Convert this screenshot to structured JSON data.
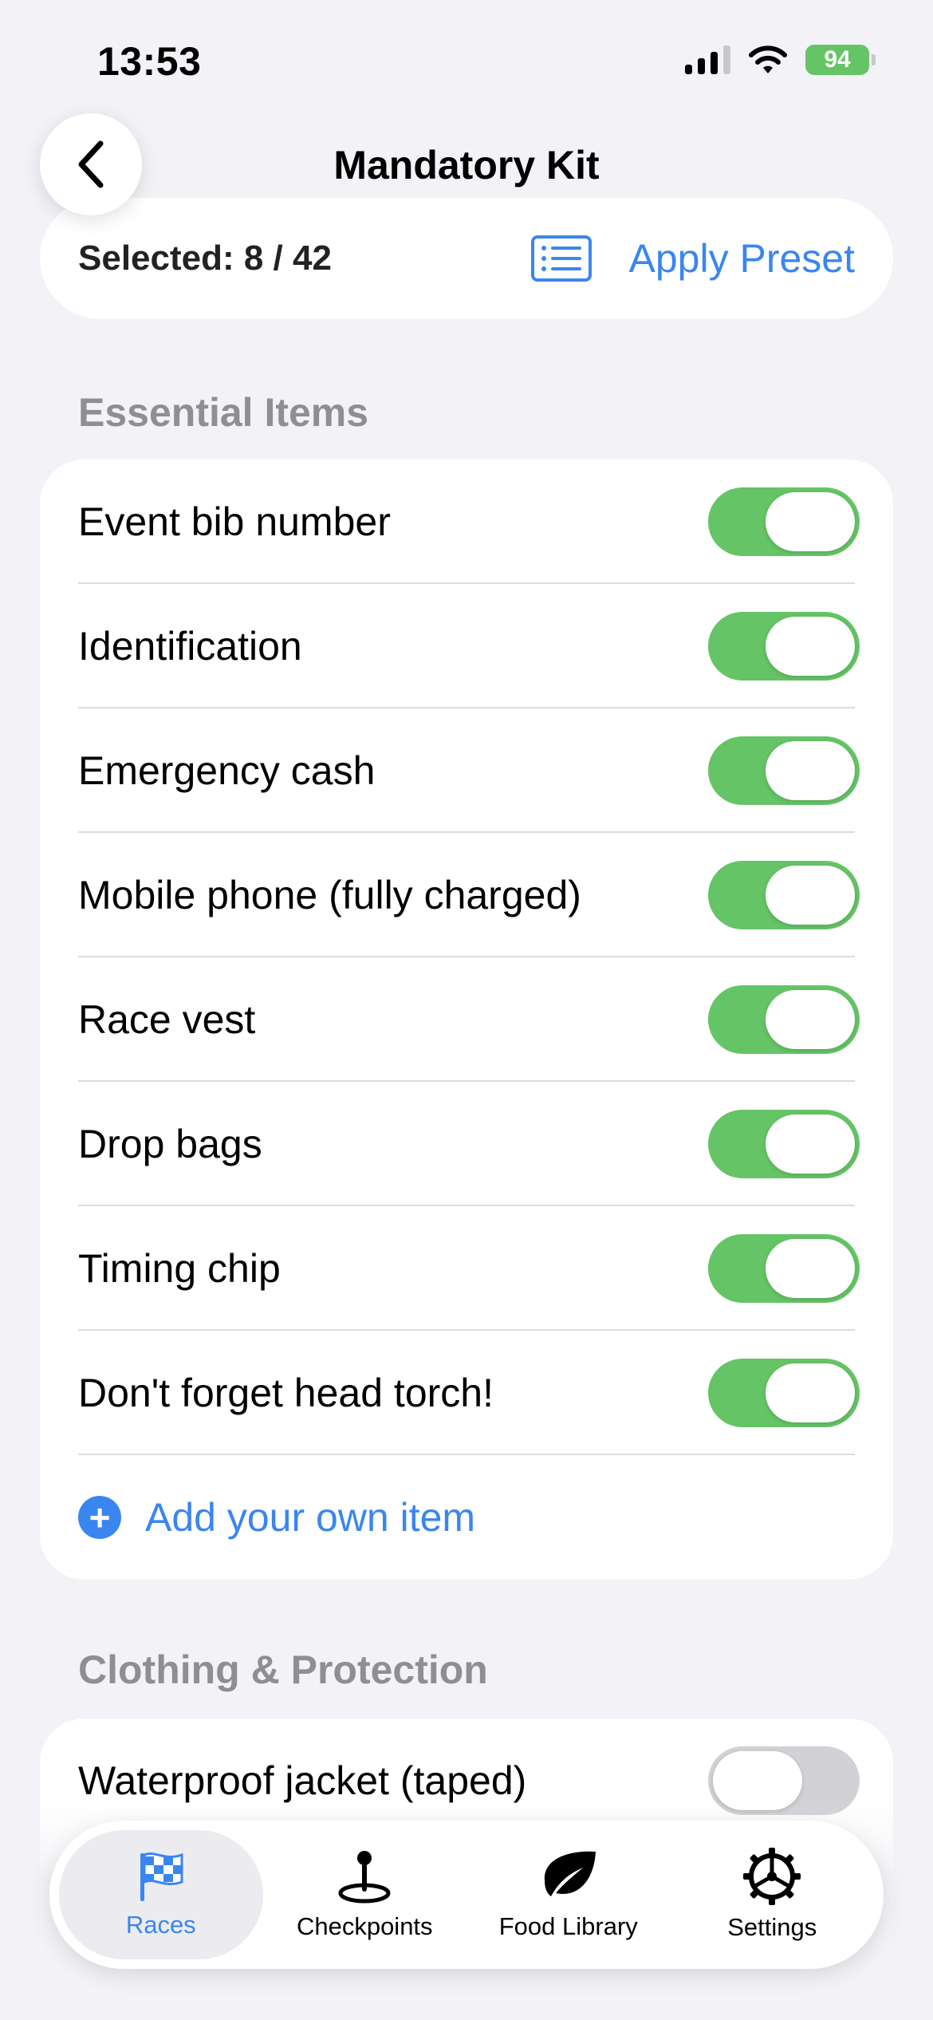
{
  "status_bar": {
    "time": "13:53",
    "battery": "94"
  },
  "nav": {
    "title": "Mandatory Kit"
  },
  "selection": {
    "selected_text": "Selected: 8 / 42",
    "preset_label": "Apply Preset"
  },
  "sections": [
    {
      "header": "Essential Items",
      "items": [
        {
          "label": "Event bib number",
          "on": true
        },
        {
          "label": "Identification",
          "on": true
        },
        {
          "label": "Emergency cash",
          "on": true
        },
        {
          "label": "Mobile phone (fully charged)",
          "on": true
        },
        {
          "label": "Race vest",
          "on": true
        },
        {
          "label": "Drop bags",
          "on": true
        },
        {
          "label": "Timing chip",
          "on": true
        },
        {
          "label": "Don't forget head torch!",
          "on": true
        }
      ],
      "add_label": "Add your own item"
    },
    {
      "header": "Clothing & Protection",
      "items": [
        {
          "label": "Waterproof jacket (taped)",
          "on": false
        }
      ]
    }
  ],
  "tabs": [
    {
      "label": "Races",
      "icon": "checkered-flag-icon",
      "active": true
    },
    {
      "label": "Checkpoints",
      "icon": "map-pin-icon",
      "active": false
    },
    {
      "label": "Food Library",
      "icon": "leaf-icon",
      "active": false
    },
    {
      "label": "Settings",
      "icon": "gear-icon",
      "active": false
    }
  ],
  "colors": {
    "accent": "#3a86f0",
    "toggle_on": "#65c466",
    "toggle_off": "#d1d1d6",
    "background": "#f2f2f7"
  }
}
